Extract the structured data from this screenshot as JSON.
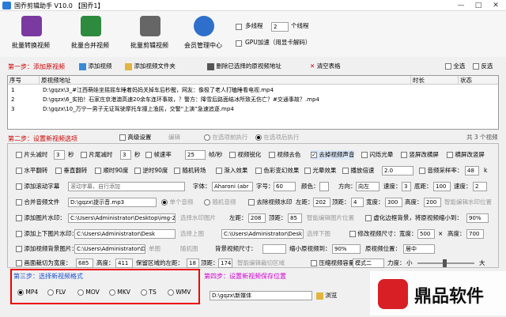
{
  "window": {
    "title": "国乔剪辑助手 V10.0  【国乔1】"
  },
  "toolbar": {
    "items": [
      {
        "label": "批量转换视频",
        "color": "#7a3aa0"
      },
      {
        "label": "批量合并视频",
        "color": "#2e8b3e"
      },
      {
        "label": "批量剪辑视频",
        "color": "#666666"
      },
      {
        "label": "会员管理中心",
        "color": "#2f6fcc"
      }
    ],
    "multithread_label": "多线程",
    "threads": "2",
    "threads_unit": "个线程",
    "gpu_label": "GPU加速（用显卡解码）"
  },
  "step1": {
    "title": "第一步：添加原视频",
    "add_video": "添加视频",
    "add_folder": "添加视频文件夹",
    "delete": "删除已选择的原视频地址",
    "clear": "清空表格",
    "select_all": "全选",
    "invert": "反选"
  },
  "table": {
    "headers": [
      "序号",
      "原视频地址",
      "时长",
      "状态"
    ],
    "rows": [
      {
        "n": "1",
        "path": "D:\\gqzx\\3_#江西萌娃坐摇摇车睡着妈妈关掉车后秒醒，网友：像极了老人打瞌睡看电视.mp4"
      },
      {
        "n": "2",
        "path": "D:\\gqzx\\6_实拍！石家庄京港澳高速20余车连环事故，？警方：降雪后路面结冰所致无伤亡？#交通事故？.mp4"
      },
      {
        "n": "3",
        "path": "D:\\gqzx\\10_万宁一男子无证驾驶摩托车撞上渔民，交警“上演”急速追逐.mp4"
      }
    ],
    "count": "共 3 个视频"
  },
  "step2": {
    "title": "第二步：设置新视频选项",
    "advanced": "高级设置",
    "edit": "编辑",
    "before": "在选项前执行",
    "after": "在选项后执行",
    "r1": {
      "head_cut": "片头减时",
      "head_val": "3",
      "sec": "秒",
      "tail_cut": "片尾减时",
      "tail_val": "3",
      "sec2": "秒",
      "fps": "帧速率",
      "fps_val": "25",
      "fps_unit": "帧/秒",
      "sharpen": "视频锐化",
      "decolor": "视频去色",
      "remove_audio": "去掉视频声音",
      "flash": "闪烁光晕",
      "to_vertical": "竖屏改横屏",
      "to_horizontal": "横屏改竖屏"
    },
    "r2": {
      "hflip": "水平翻转",
      "vflip": "垂直翻转",
      "cw90": "顺时90度",
      "ccw90": "逆时90度",
      "fx1": "随机转场",
      "fade": "渐入效果",
      "retro": "色彩变幻效果",
      "light": "光晕效果",
      "speed": "播放倍速",
      "speed_val": "2.0",
      "samplerate": "音频采样率：",
      "sr_val": "48",
      "k": "k"
    },
    "r3": {
      "add_text": "添加滚动字幕",
      "text_ph": "滚动字幕，自行添加",
      "font": "字体：",
      "font_val": "Aharoni (abr",
      "size": "字号：",
      "size_val": "60",
      "color": "颜色：",
      "dir": "方向：",
      "dir_val": "向左",
      "speed": "速度：",
      "speed_val": "3",
      "bottom": "底距：",
      "bottom_val": "100",
      "speed2": "速度：",
      "speed2_val": "2"
    },
    "r4": {
      "merge": "合并音频文件",
      "audio_path": "D:\\gqzx\\提示音.mp3",
      "single": "单个音频",
      "random": "随机音频",
      "wm": "去除视频水印",
      "left": "左距：",
      "left_val": "202",
      "top": "顶距：",
      "top_val": "4",
      "width": "宽度：",
      "width_val": "300",
      "height": "高度：",
      "height_val": "200",
      "smart": "智能编辑水印位置"
    },
    "r5": {
      "pic_wm": "添加图片水印：",
      "pic_path": "C:\\Users\\Administrator\\Desktop\\img-2",
      "sel": "选择水印图片",
      "left": "左距：",
      "left_val": "208",
      "top": "顶距：",
      "top_val": "85",
      "smart": "智能编辑图片位置",
      "blur": "虚化边框背景，将原视频缩小到：",
      "blur_val": "90%"
    },
    "r6": {
      "cover": "添加上下图片水印：",
      "top_path": "C:\\Users\\Administrator\\Desk",
      "sel_top": "选择上图",
      "bot_path": "C:\\Users\\Administrator\\Desk",
      "sel_bot": "选择下图",
      "resize": "修改视频尺寸：",
      "w": "宽度：",
      "w_val": "500",
      "x": "×",
      "h": "高度：",
      "h_val": "700"
    },
    "r7": {
      "bgimg": "添加视频背景图片：",
      "bg_path": "C:\\Users\\Administrator\\Desktop",
      "one": "单图",
      "rand": "随机图",
      "bgsize": "背景视频尺寸：",
      "bgsize_val": "",
      "scale": "缩小原视频到：",
      "scale_val": "90%",
      "pos": "原视频位置：",
      "pos_val": "居中"
    },
    "r8": {
      "crop": "画面裁切为宽度：",
      "crop_w": "685",
      "crop_h_lbl": "高度：",
      "crop_h": "411",
      "keep": "保留区域的左距：",
      "keep_val": "18",
      "top": "顶距：",
      "top_val": "174",
      "smart": "智能编辑裁切区域",
      "compress": "压缩视频容量",
      "mode": "模式二",
      "force": "力度：",
      "small": "小",
      "big": "大"
    }
  },
  "step3": {
    "title": "第三步：选择新视频格式",
    "formats": [
      "MP4",
      "FLV",
      "MOV",
      "MKV",
      "TS",
      "WMV"
    ],
    "selected": "MP4"
  },
  "step4": {
    "title": "第四步：设置新视频保存位置",
    "path": "D:\\gqzx\\新媒体",
    "browse": "浏览"
  },
  "watermark": {
    "text": "鼎品软件"
  }
}
